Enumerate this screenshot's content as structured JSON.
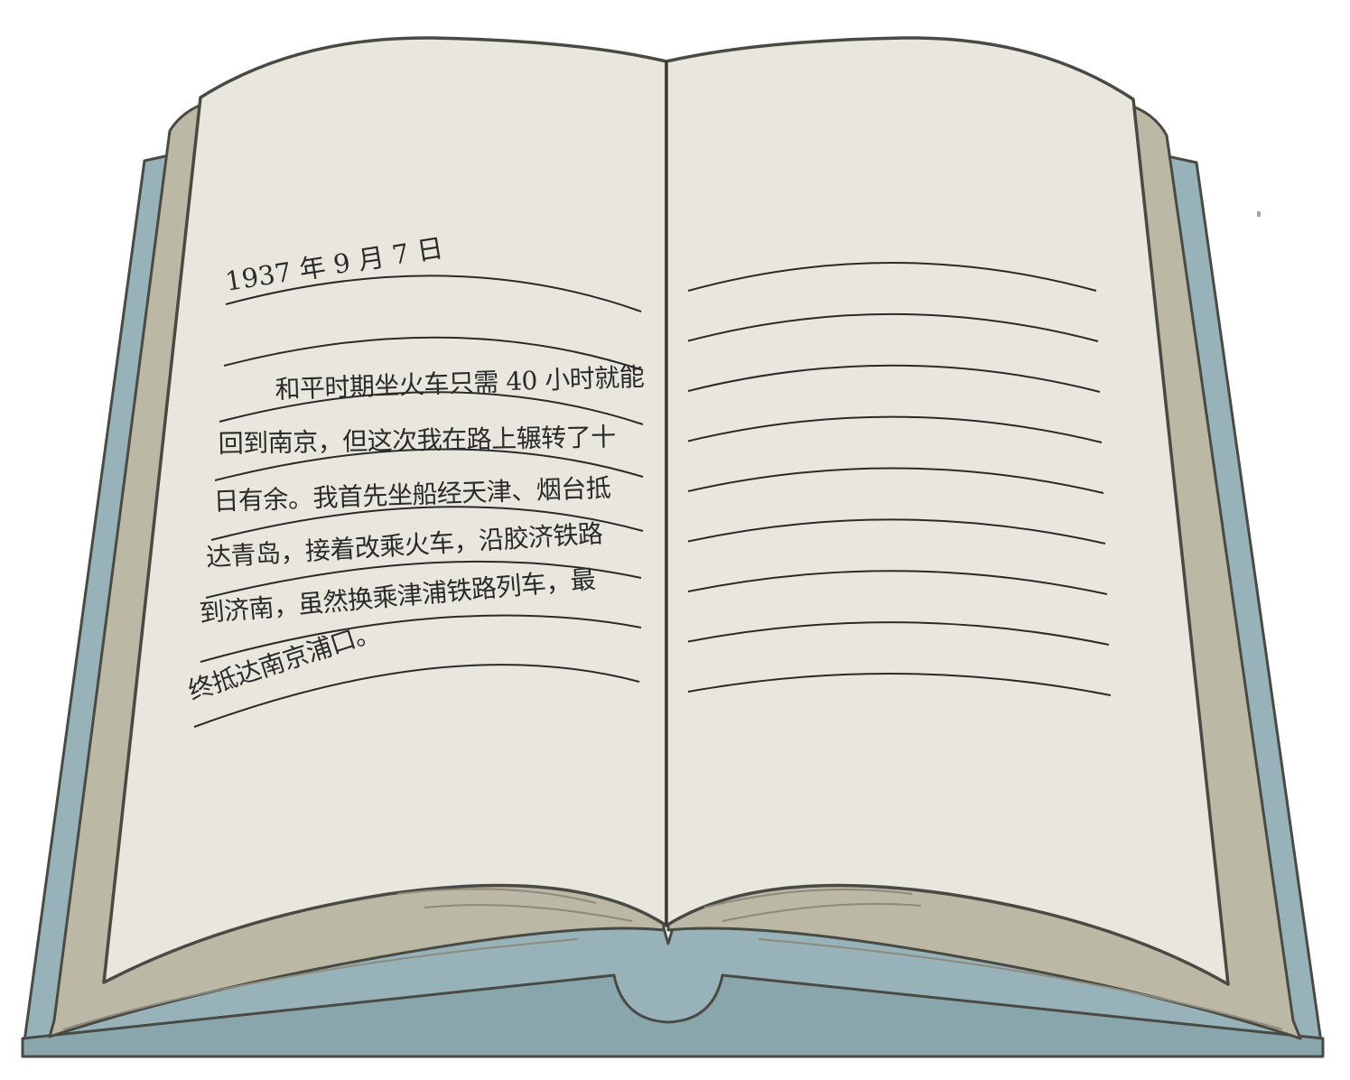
{
  "book": {
    "colors": {
      "cover": "#97b2b8",
      "cover_edge": "#6f8d95",
      "page": "#e9e7dd",
      "page_stack": "#bcb8a6",
      "outline": "#4a4a44",
      "ink": "#2a2a2a"
    },
    "left_page": {
      "date": "1937 年 9 月 7 日",
      "lines": [
        "和平时期坐火车只需 40 小时就能",
        "回到南京，但这次我在路上辗转了十",
        "日有余。我首先坐船经天津、烟台抵",
        "达青岛，接着改乘火车，沿胶济铁路",
        "到济南，虽然换乘津浦铁路列车，最",
        "终抵达南京浦口。"
      ]
    },
    "right_page": {
      "blank_line_count": 9
    }
  }
}
